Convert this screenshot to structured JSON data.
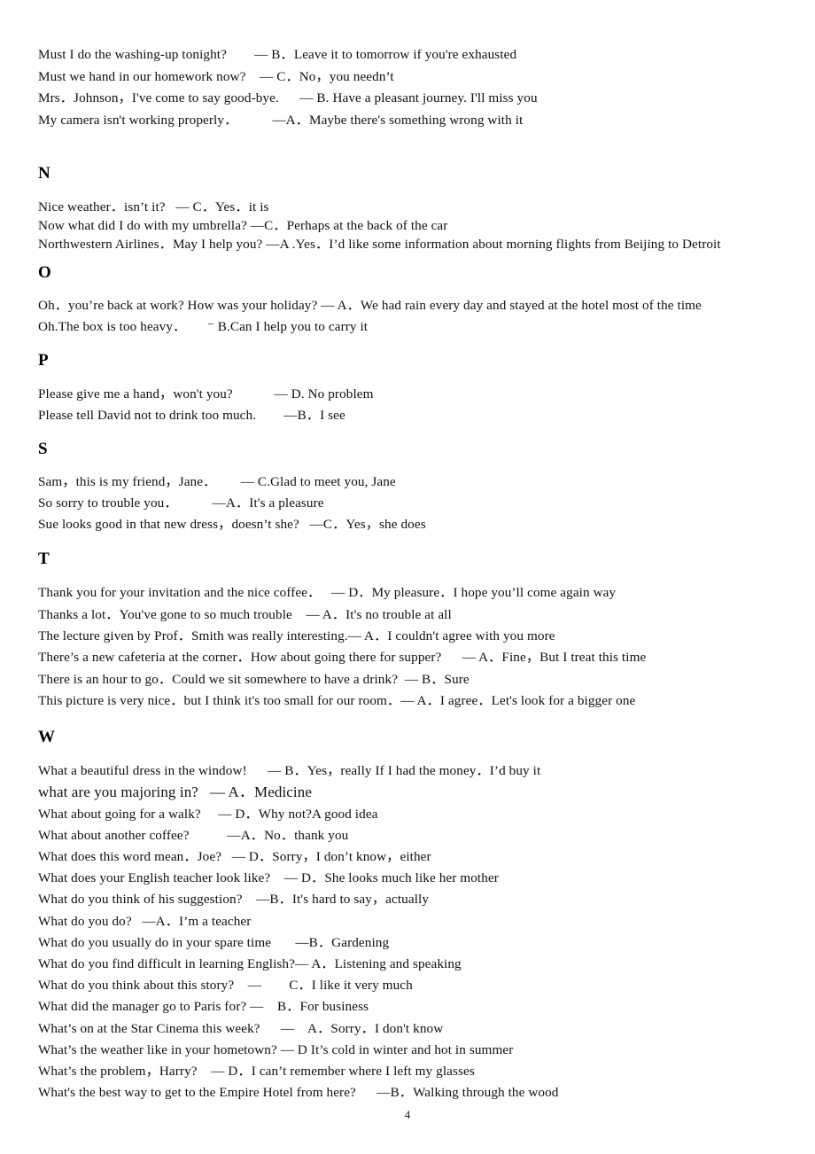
{
  "document": {
    "page_number": "4",
    "sections": [
      {
        "id": "m",
        "letter": "",
        "show_letter": false,
        "lines": [
          "Must I do the washing-up tonight?        — B．Leave it to tomorrow if you're exhausted",
          "Must we hand in our homework now?    — C．No，you needn’t",
          "Mrs．Johnson，I've come to say good-bye.      — B. Have a pleasant journey. I'll miss you",
          "My camera isn't working properly．          —A．Maybe there's something wrong with it"
        ]
      },
      {
        "id": "n",
        "letter": "N",
        "show_letter": true,
        "lines": [
          "Nice weather．isn’t it?   — C．Yes．it is",
          "Now what did I do with my umbrella? —C．Perhaps at the back of the car",
          "Northwestern Airlines．May I help you? —A .Yes．I’d like some information about morning flights from Beijing to Detroit"
        ]
      },
      {
        "id": "o",
        "letter": "O",
        "show_letter": true,
        "lines": [
          "Oh．you’re back at work? How was your holiday? — A．We had rain every day and stayed at the hotel most of the time",
          "Oh.The box is too heavy．      ⁻ B.Can I help you to carry it"
        ]
      },
      {
        "id": "p",
        "letter": "P",
        "show_letter": true,
        "lines": [
          "Please give me a hand，won't you?            — D. No problem",
          "Please tell David not to drink too much.        —B．I see"
        ]
      },
      {
        "id": "s",
        "letter": "S",
        "show_letter": true,
        "lines": [
          "Sam，this is my friend，Jane．       — C.Glad to meet you, Jane",
          "So sorry to trouble you．          —A．It's a pleasure",
          "Sue looks good in that new dress，doesn’t she?   —C．Yes，she does"
        ]
      },
      {
        "id": "t",
        "letter": "T",
        "show_letter": true,
        "lines": [
          "Thank you for your invitation and the nice coffee．   — D．My pleasure．I hope you’ll come again way",
          "Thanks a lot．You've gone to so much trouble    — A．It's no trouble at all",
          "The lecture given by Prof．Smith was really interesting.— A．I couldn't agree with you more",
          "There’s a new cafeteria at the corner．How about going there for supper?      — A．Fine，But I treat this time",
          "There is an hour to go．Could we sit somewhere to have a drink?  — B．Sure",
          "This picture is very nice．but I think it's too small for our room．— A．I agree．Let's look for a bigger one"
        ]
      },
      {
        "id": "w",
        "letter": "W",
        "show_letter": true,
        "lines": [
          "What a beautiful dress in the window!      — B．Yes，really If I had the money．I’d buy it",
          "what are you majoring in?   — A．Medicine",
          "What about going for a walk?     — D．Why not?A good idea",
          "What about another coffee?           —A．No．thank you",
          "What does this word mean．Joe?   — D．Sorry，I don’t know，either",
          "What does your English teacher look like?    — D．She looks much like her mother",
          "What do you think of his suggestion?    —B．It's hard to say，actually",
          "What do you do?   —A．I’m a teacher",
          "What do you usually do in your spare time       —B．Gardening",
          "What do you find difficult in learning English?— A．Listening and speaking",
          "What do you think about this story?    —        C．I like it very much",
          "What did the manager go to Paris for? —    B．For business",
          "What’s on at the Star Cinema this week?      —    A．Sorry．I don't know",
          "What’s the weather like in your hometown? — D It’s cold in winter and hot in summer",
          "What’s the problem，Harry?    — D．I can’t remember where I left my glasses",
          "What's the best way to get to the Empire Hotel from here?      —B．Walking through the wood"
        ],
        "bigger_line_index": 1
      }
    ]
  }
}
